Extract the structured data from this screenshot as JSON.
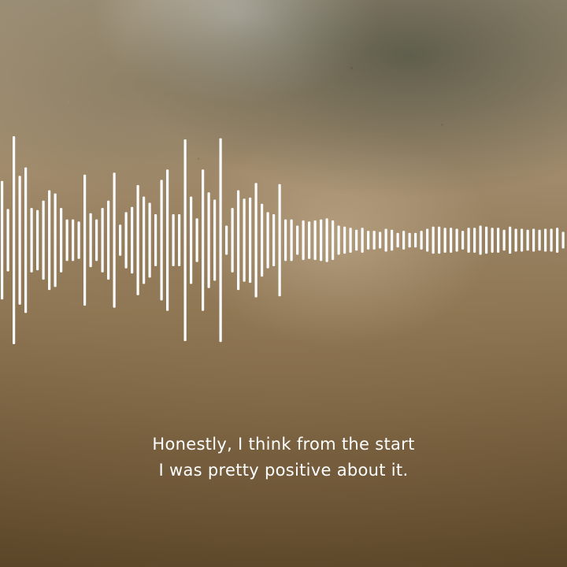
{
  "background": {
    "description_color_top": "#9a8d75",
    "description_color_bottom": "#5b4629"
  },
  "waveform": {
    "color": "#ffffff",
    "amplitudes": [
      0.57,
      0.3,
      1.0,
      0.62,
      0.7,
      0.31,
      0.29,
      0.38,
      0.48,
      0.45,
      0.31,
      0.2,
      0.2,
      0.18,
      0.63,
      0.26,
      0.2,
      0.31,
      0.38,
      0.65,
      0.15,
      0.27,
      0.32,
      0.53,
      0.42,
      0.36,
      0.25,
      0.58,
      0.68,
      0.25,
      0.25,
      0.97,
      0.42,
      0.21,
      0.68,
      0.46,
      0.39,
      0.98,
      0.14,
      0.31,
      0.48,
      0.4,
      0.41,
      0.55,
      0.35,
      0.27,
      0.25,
      0.54,
      0.2,
      0.2,
      0.14,
      0.19,
      0.18,
      0.19,
      0.2,
      0.21,
      0.19,
      0.14,
      0.13,
      0.12,
      0.1,
      0.12,
      0.09,
      0.09,
      0.08,
      0.11,
      0.1,
      0.07,
      0.09,
      0.07,
      0.07,
      0.09,
      0.11,
      0.13,
      0.13,
      0.12,
      0.12,
      0.11,
      0.09,
      0.12,
      0.12,
      0.14,
      0.13,
      0.12,
      0.12,
      0.1,
      0.13,
      0.11,
      0.11,
      0.1,
      0.11,
      0.1,
      0.11,
      0.11,
      0.12,
      0.08
    ]
  },
  "caption": {
    "line1": "Honestly, I think from the start",
    "line2": "I was pretty positive about it."
  }
}
